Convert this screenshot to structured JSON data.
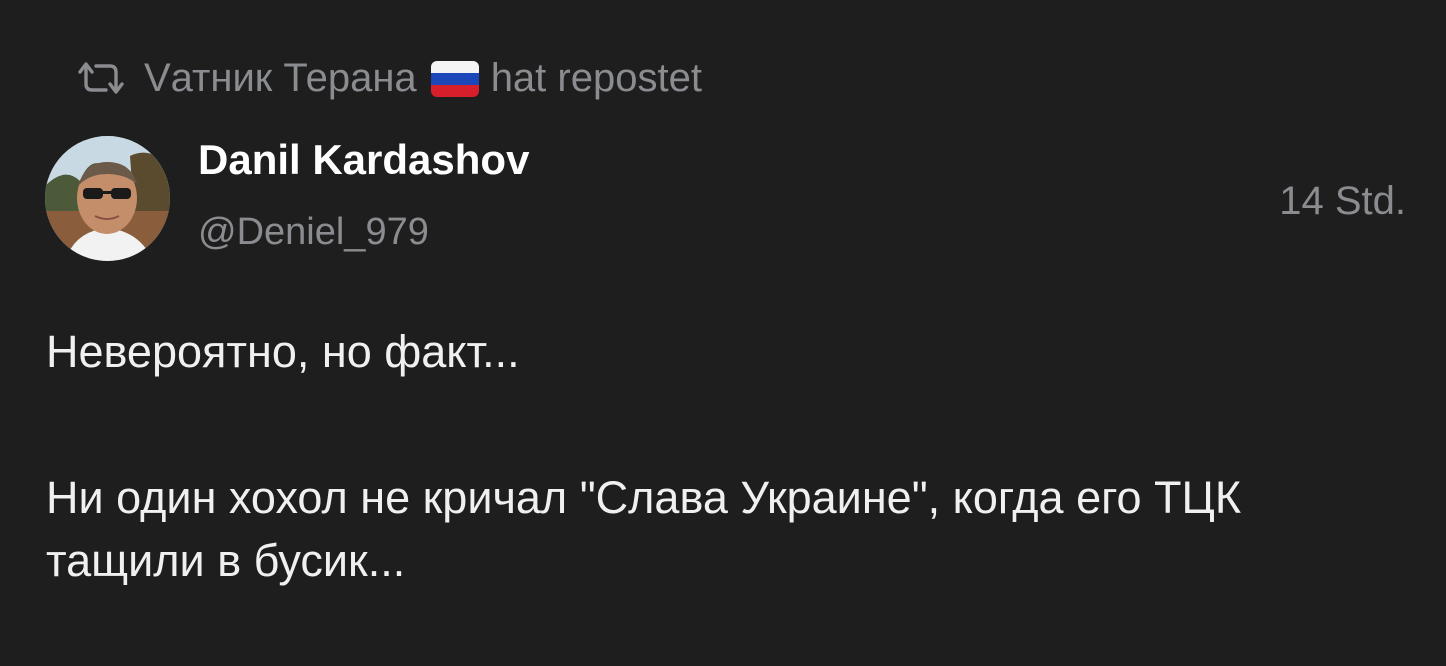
{
  "repost": {
    "icon": "repost-icon",
    "user": "Vатник Терана",
    "flag": "russia-flag-icon",
    "action": "hat repostet"
  },
  "author": {
    "avatar": "avatar-photo",
    "name": "Danil Kardashov",
    "handle": "@Deniel_979"
  },
  "timestamp": "14 Std.",
  "content": {
    "line1": "Невероятно, но факт...",
    "line2": "Ни один хохол не кричал \"Слава Украине\", когда его ТЦК тащили в бусик..."
  },
  "colors": {
    "background": "#1e1e1e",
    "muted": "#8a8c90",
    "text": "#f0f0f0",
    "name": "#ffffff"
  }
}
